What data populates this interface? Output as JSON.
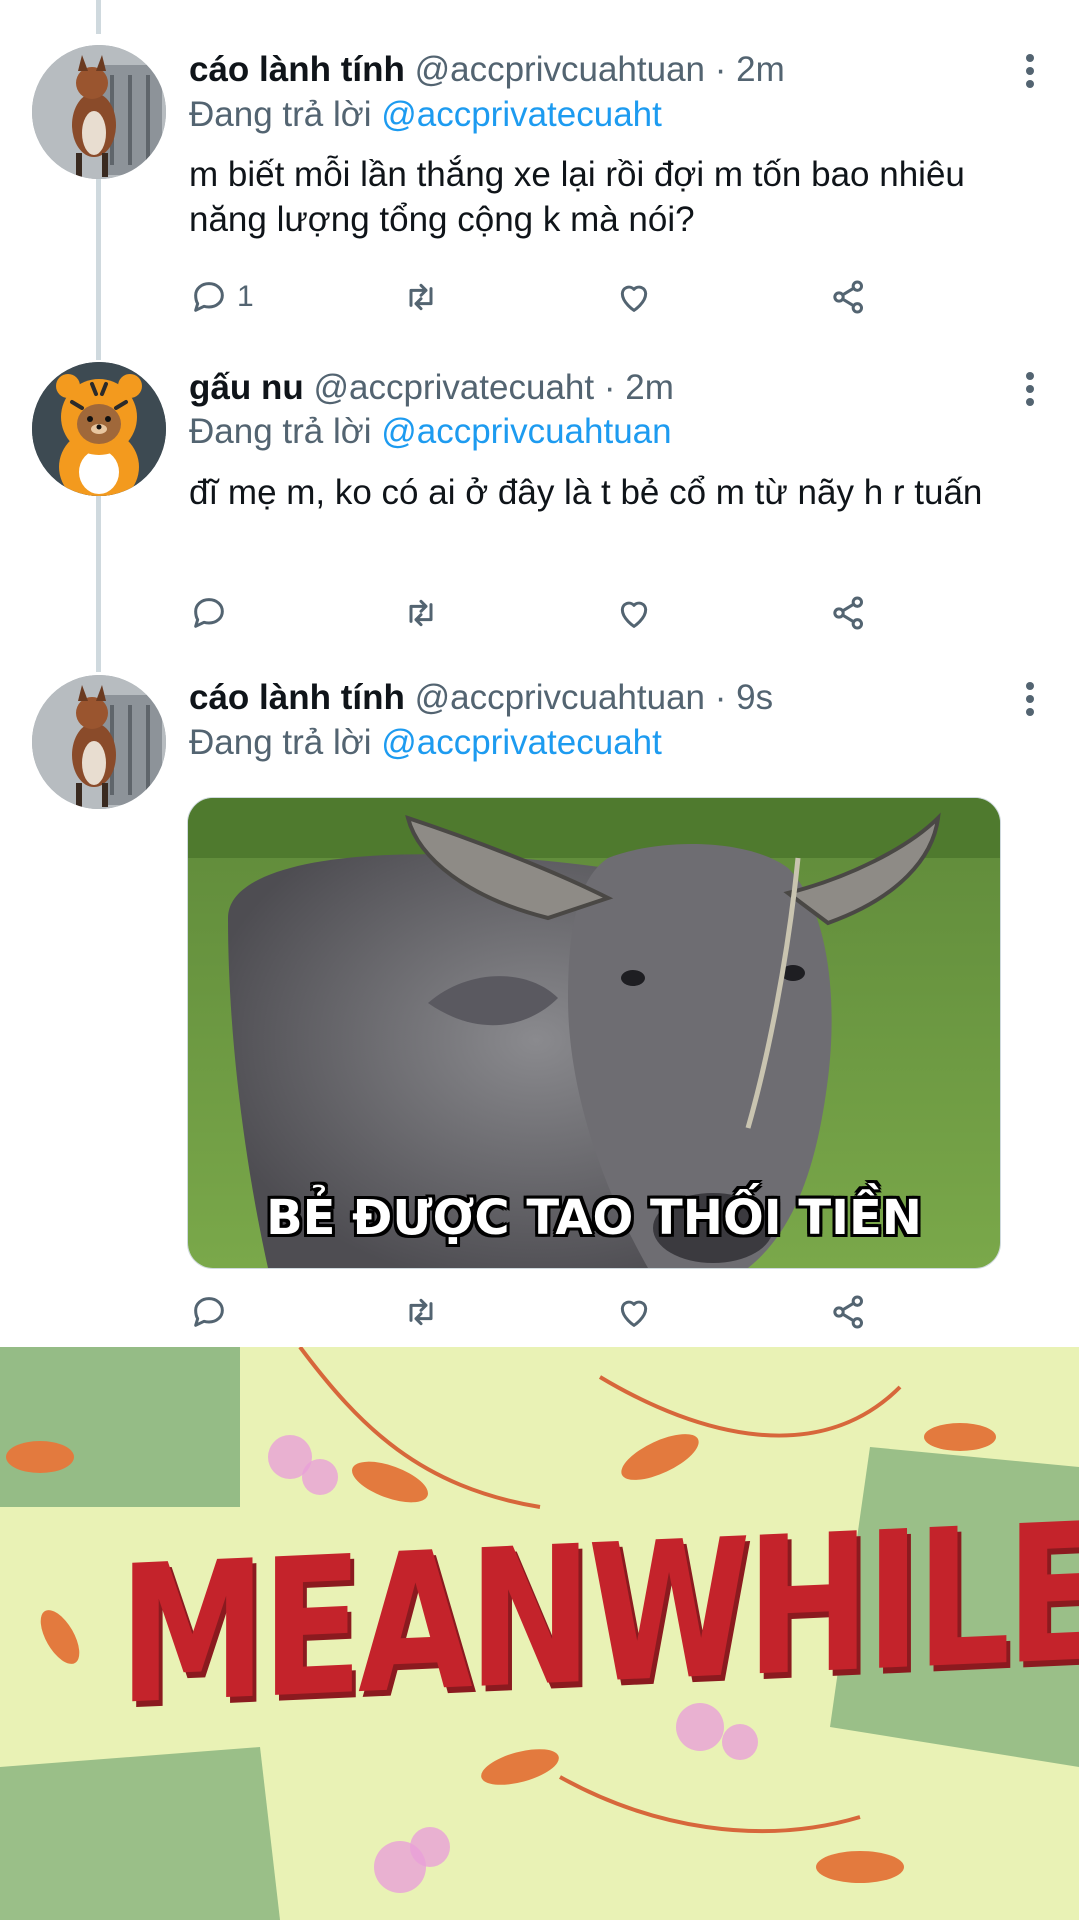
{
  "tweets": [
    {
      "name": "cáo lành tính",
      "handle": "@accprivcuahtuan",
      "time": "· 2m",
      "reply_prefix": "Đang trả lời",
      "reply_to": "@accprivatecuaht",
      "text": "m biết mỗi lần thắng xe lại rồi đợi m tốn bao nhiêu năng lượng tổng cộng k mà nói?",
      "reply_count": "1",
      "avatar": "fox-on-chair"
    },
    {
      "name": "gấu nu",
      "handle": "@accprivatecuaht",
      "time": "· 2m",
      "reply_prefix": "Đang trả lời",
      "reply_to": "@accprivcuahtuan",
      "text": "đĩ mẹ m, ko có ai ở đây là t bẻ cổ m từ nãy h r tuấn",
      "reply_count": "",
      "avatar": "bear-in-tiger-costume"
    },
    {
      "name": "cáo lành tính",
      "handle": "@accprivcuahtuan",
      "time": "· 9s",
      "reply_prefix": "Đang trả lời",
      "reply_to": "@accprivatecuaht",
      "text": "",
      "reply_count": "",
      "avatar": "fox-on-chair",
      "media_caption": "BẺ ĐƯỢC TAO THỐI TIỀN"
    }
  ],
  "meanwhile_card": {
    "text": "MEANWHILE..."
  },
  "icons": [
    "reply-icon",
    "retweet-icon",
    "like-icon",
    "share-icon",
    "more-icon"
  ],
  "colors": {
    "link": "#1d9bf0",
    "muted": "#536471",
    "thread_line": "#cfd9de",
    "meanwhile_red": "#c4232b"
  }
}
